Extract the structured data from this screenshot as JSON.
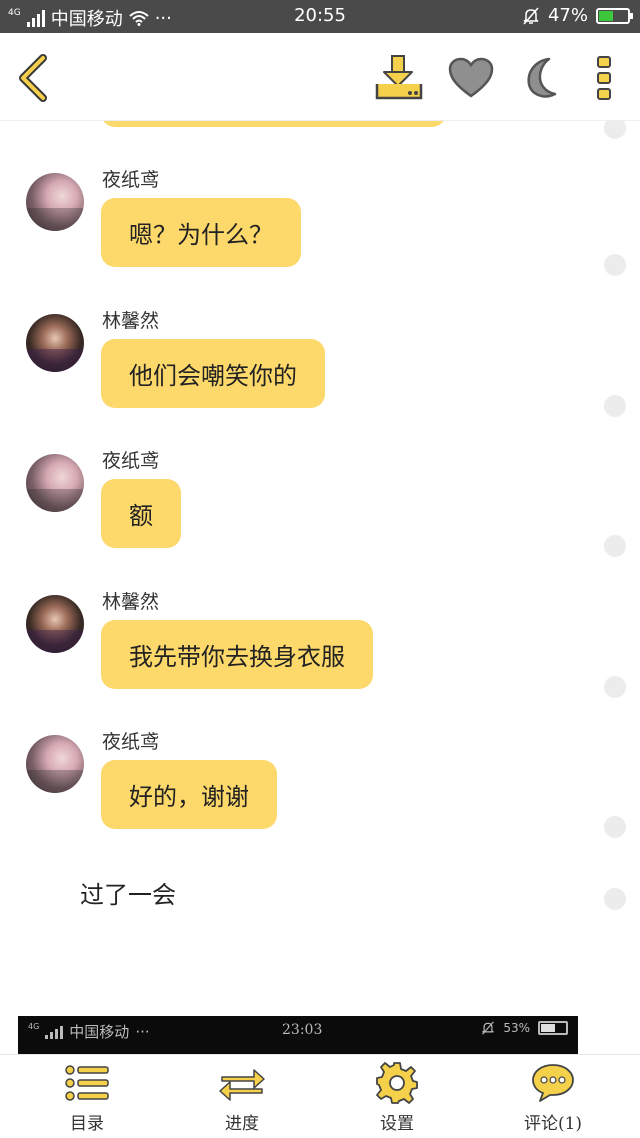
{
  "status_bar": {
    "network": "4G",
    "carrier": "中国移动",
    "more": "···",
    "time": "20:55",
    "battery": "47%",
    "battery_level": 0.47
  },
  "toolbar": {
    "back_icon": "chevron-left-icon",
    "download_icon": "download-icon",
    "favorite_icon": "heart-icon",
    "night_mode_icon": "moon-icon",
    "more_icon": "more-vertical-icon"
  },
  "messages": [
    {
      "sender": "夜纸鸢",
      "text": "嗯？为什么？",
      "avatar": "avatar-girl-light"
    },
    {
      "sender": "林馨然",
      "text": "他们会嘲笑你的",
      "avatar": "avatar-girl-dark"
    },
    {
      "sender": "夜纸鸢",
      "text": "额",
      "avatar": "avatar-girl-light"
    },
    {
      "sender": "林馨然",
      "text": "我先带你去换身衣服",
      "avatar": "avatar-girl-dark"
    },
    {
      "sender": "夜纸鸢",
      "text": "好的，谢谢",
      "avatar": "avatar-girl-light"
    }
  ],
  "narration": "过了一会",
  "embedded_screenshot": {
    "network": "4G",
    "carrier": "中国移动",
    "more": "···",
    "time": "23:03",
    "battery": "53%",
    "battery_level": 0.53
  },
  "bottom_nav": [
    {
      "label": "目录",
      "icon": "list-icon"
    },
    {
      "label": "进度",
      "icon": "swap-arrows-icon"
    },
    {
      "label": "设置",
      "icon": "gear-icon"
    },
    {
      "label": "评论(1)",
      "icon": "comment-icon"
    }
  ],
  "colors": {
    "bubble": "#fdd96b",
    "accent_yellow": "#f5d04a",
    "status_bar": "#4a4a4a"
  }
}
